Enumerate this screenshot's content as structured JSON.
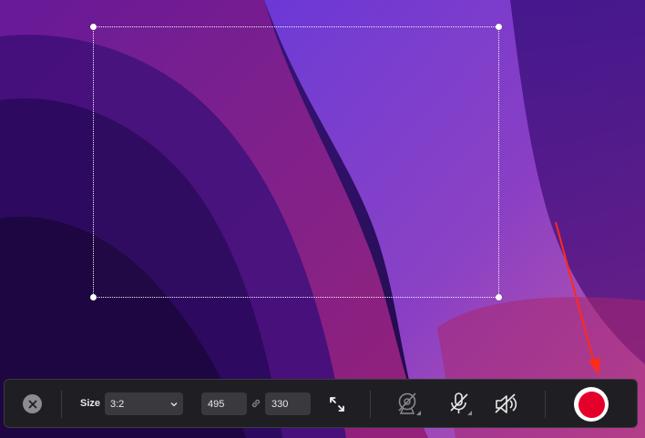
{
  "colors": {
    "wallpaper_dark": "#1f0b46",
    "wallpaper_purple": "#6a1ea0",
    "toolbar_bg": "#1f1e22",
    "field_bg": "#3a393e",
    "record_red": "#e4002b",
    "annotation_arrow": "#ff2a1a"
  },
  "toolbar": {
    "close_icon": "close-icon",
    "size_label": "Size",
    "size_value": "3:2",
    "width_value": "495",
    "height_value": "330",
    "link_icon": "link-icon",
    "expand_icon": "expand-arrows-icon",
    "camera_icon": "camera-off-icon",
    "mic_icon": "microphone-off-icon",
    "speaker_icon": "speaker-off-icon",
    "record_icon": "record-icon"
  },
  "selection": {
    "width": 495,
    "height": 330,
    "aspect_ratio": "3:2"
  }
}
